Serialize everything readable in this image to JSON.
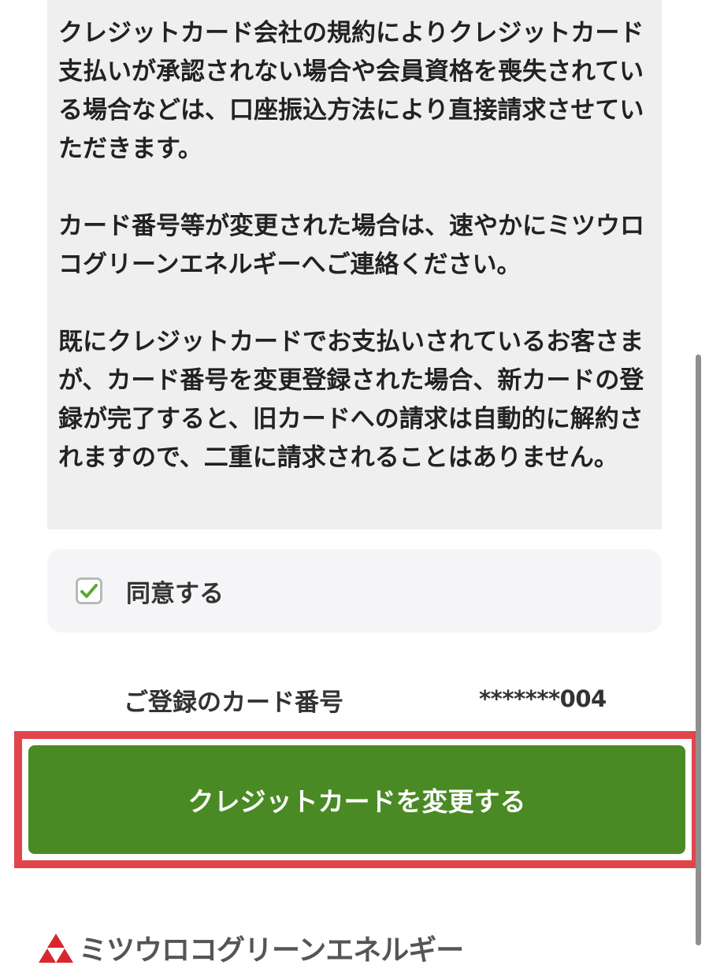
{
  "terms": {
    "paragraphs": [
      "クレジットカード会社の規約によりクレジットカード支払いが承認されない場合や会員資格を喪失されている場合などは、口座振込方法により直接請求させていただきます。",
      "カード番号等が変更された場合は、速やかにミツウロコグリーンエネルギーへご連絡ください。",
      "既にクレジットカードでお支払いされているお客さまが、カード番号を変更登録された場合、新カードの登録が完了すると、旧カードへの請求は自動的に解約されますので、二重に請求されることはありません。"
    ]
  },
  "agree": {
    "label": "同意する",
    "checked": true,
    "check_color": "#5aa832"
  },
  "card": {
    "label": "ご登録のカード番号",
    "number": "*******004"
  },
  "action": {
    "button_label": "クレジットカードを変更する",
    "button_color": "#4a8a24",
    "highlight_color": "#e2444c"
  },
  "footer": {
    "logo_icon": "mitsuuroko-triangle-logo",
    "logo_text": "ミツウロコグリーンエネルギー",
    "logo_color": "#d9262e"
  }
}
